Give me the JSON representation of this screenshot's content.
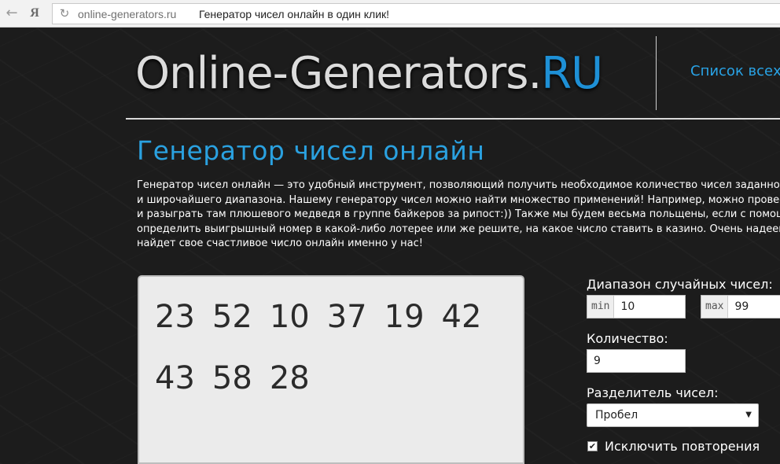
{
  "browser": {
    "back_icon": "←",
    "yandex_logo": "Я",
    "reload_icon": "↻",
    "domain": "online-generators.ru",
    "page_title": "Генератор чисел онлайн в один клик!"
  },
  "header": {
    "logo_main": "Online-Generators.",
    "logo_tld": "RU",
    "nav_link": "Список всех"
  },
  "main": {
    "title": "Генератор чисел онлайн",
    "intro_lines": [
      "Генератор чисел онлайн — это удобный инструмент, позволяющий получить необходимое количество чисел заданно",
      "и широчайшего диапазона. Нашему генератору чисел можно найти множество применений! Например, можно провести",
      "и разыграть там плюшевого медведя в группе байкеров за рипост:)) Также мы будем весьма польщены, если с помощ",
      "определить выигрышный номер в какой-либо лотерее или же решите, на какое число ставить в казино. Очень надеем",
      "найдет свое счастливое число онлайн именно у нас!"
    ]
  },
  "result": {
    "numbers": [
      "23",
      "52",
      "10",
      "37",
      "19",
      "42",
      "43",
      "58",
      "28"
    ]
  },
  "settings": {
    "range_label": "Диапазон случайных чисел:",
    "min_tag": "min",
    "min_value": "10",
    "max_tag": "max",
    "max_value": "99",
    "count_label": "Количество:",
    "count_value": "9",
    "separator_label": "Разделитель чисел:",
    "separator_value": "Пробел",
    "exclude_label": "Исключить повторения",
    "exclude_checked": true
  },
  "colors": {
    "accent": "#2aa1e0",
    "background": "#1c1c1c"
  }
}
